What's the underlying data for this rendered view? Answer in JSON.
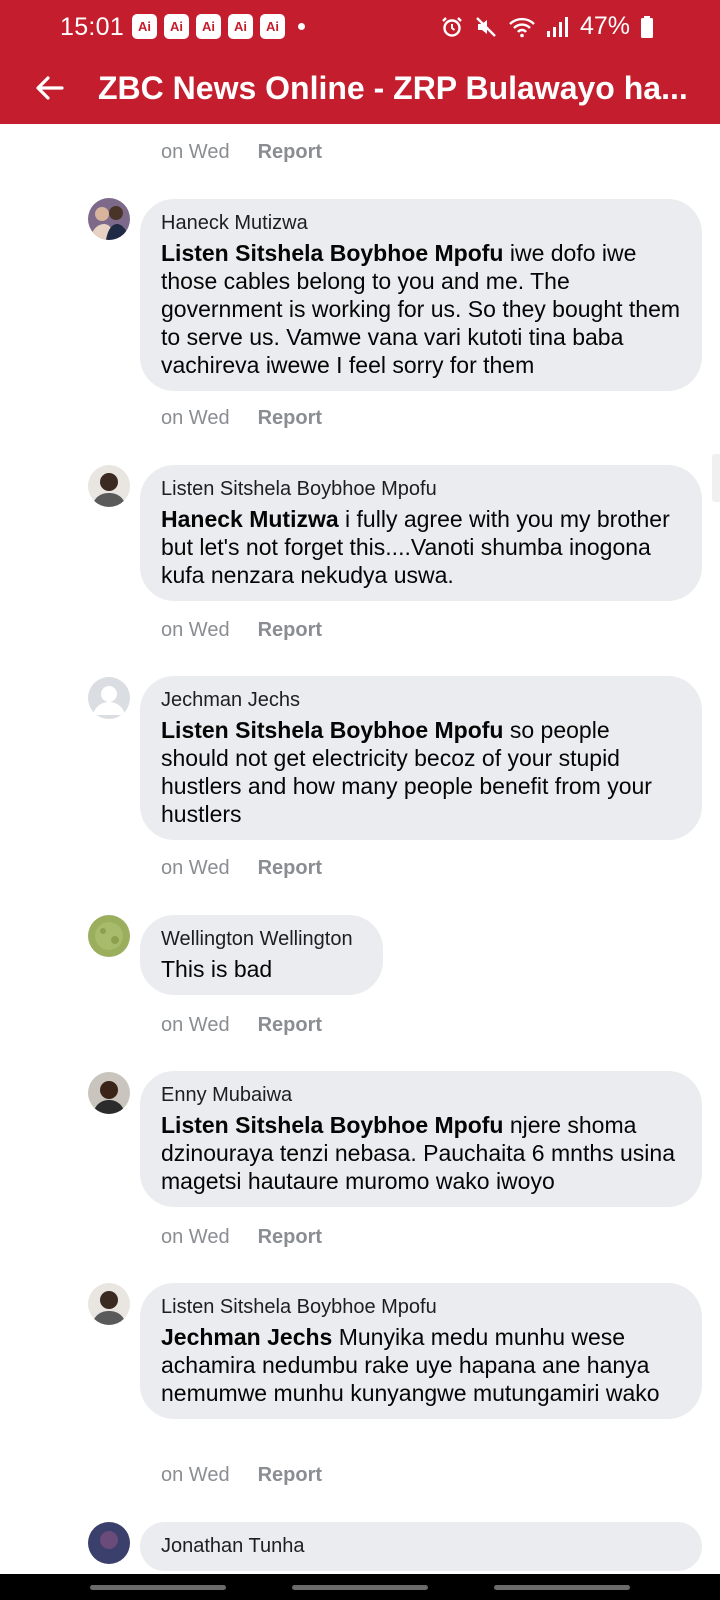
{
  "status_bar": {
    "time": "15:01",
    "ai_badges": [
      "Ai",
      "Ai",
      "Ai",
      "Ai",
      "Ai"
    ],
    "battery": "47%",
    "icons": [
      "alarm-icon",
      "mute-icon",
      "wifi-icon",
      "signal-icon",
      "battery-icon"
    ]
  },
  "header": {
    "title": "ZBC News Online - ZRP Bulawayo ha...",
    "back_icon": "arrow-left-icon",
    "color": "#c41e2e"
  },
  "labels": {
    "time": "on Wed",
    "report": "Report"
  },
  "comments": [
    {
      "author": "Haneck Mutizwa",
      "mention": "Listen Sitshela Boybhoe Mpofu",
      "text": " iwe dofo iwe those cables belong to you and me. The government is working for us. So they bought them to serve us. Vamwe vana vari kutoti tina baba vachireva iwewe I feel sorry for them",
      "time": "on Wed",
      "report": "Report"
    },
    {
      "author": "Listen Sitshela Boybhoe Mpofu",
      "mention": "Haneck Mutizwa",
      "text": " i fully agree with you my brother but let's not forget this....Vanoti shumba inogona kufa nenzara nekudya uswa.",
      "time": "on Wed",
      "report": "Report"
    },
    {
      "author": "Jechman Jechs",
      "mention": "Listen Sitshela Boybhoe Mpofu",
      "text": " so people should not get electricity becoz of your stupid hustlers and how many people benefit from your hustlers",
      "time": "on Wed",
      "report": "Report"
    },
    {
      "author": "Wellington Wellington",
      "mention": "",
      "text": "This is bad",
      "time": "on Wed",
      "report": "Report"
    },
    {
      "author": "Enny Mubaiwa",
      "mention": "Listen Sitshela Boybhoe Mpofu",
      "text": " njere shoma dzinouraya tenzi nebasa. Pauchaita 6 mnths usina magetsi hautaure muromo wako iwoyo",
      "time": "on Wed",
      "report": "Report"
    },
    {
      "author": "Listen Sitshela Boybhoe Mpofu",
      "mention": "Jechman Jechs",
      "text": " Munyika medu munhu wese achamira nedumbu rake uye hapana ane hanya nemumwe munhu kunyangwe mutungamiri wako",
      "time": "on Wed",
      "report": "Report"
    },
    {
      "author": "Jonathan Tunha",
      "mention": "",
      "text": "",
      "time": "",
      "report": ""
    }
  ]
}
